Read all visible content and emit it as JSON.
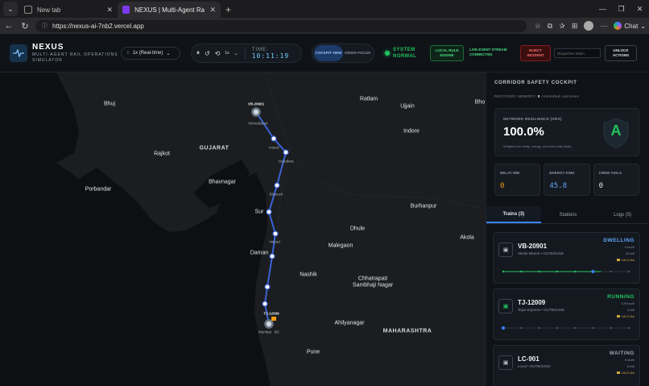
{
  "browser": {
    "tab1_title": "New tab",
    "tab2_title": "NEXUS | Multi-Agent Rail Network",
    "url": "https://nexus-ai-7nb2.vercel.app",
    "chat_label": "Chat"
  },
  "header": {
    "brand": "NEXUS",
    "subtitle_line1": "MULTI-AGENT RAIL OPERATIONS",
    "subtitle_line2": "SIMULATOR",
    "speed": "1x (Real-time)",
    "speed_step": "1x",
    "time_label": "TIME:",
    "time_value": "10:11:19",
    "mode_cockpit": "COCKPIT VIEW",
    "mode_crisis": "CRISIS FOCUS",
    "system_line1": "SYSTEM",
    "system_line2": "NORMAL",
    "rule_engine": "LOCAL RULE ENGINE",
    "event_stream_line1": "LIVE EVENT STREAM",
    "event_stream_line2": "CONNECTED",
    "inject_incident": "INJECT INCIDENT",
    "dispatcher_placeholder": "Dispatcher token",
    "unlock_actions": "UNLOCK ACTIONS"
  },
  "colors": {
    "route": "#3b63d6",
    "accent": "#3b82f6",
    "ok": "#22c55e",
    "danger": "#f87171",
    "warning": "#f59e0b"
  },
  "map": {
    "labels": {
      "bhuj": "Bhuj",
      "ratlam": "Ratlam",
      "ujjain": "Ujjain",
      "bho": "Bho",
      "indore": "Indore",
      "rajkot": "Rajkot",
      "gujarat": "GUJARAT",
      "porbandar": "Porbandar",
      "bhavnagar": "Bhavnagar",
      "burhanpur": "Burhanpur",
      "dhule": "Dhule",
      "akola": "Akola",
      "malegaon": "Malegaon",
      "nashik": "Nashik",
      "chhatrapati1": "Chhatrapati",
      "chhatrapati2": "Sambhaji Nagar",
      "maharashtra": "MAHARASHTRA",
      "ahilyanagar": "Ahilyanagar",
      "pune": "Pune",
      "surat": "Sur",
      "daman": "Daman",
      "anand": "Anand",
      "vadodara": "Vadodara",
      "bharuch": "Bharuch",
      "valsad": "Valsad",
      "ahmedabad": "Ahmedabad",
      "mumbai": "Mumbai",
      "mumbai_suffix": "BC",
      "train_vb": "VB-20901",
      "train_tj": "TJ-12009"
    }
  },
  "panel": {
    "title": "CORRIDOR SAFETY COCKPIT",
    "recovery_prefix": "RECOVERY MEMORY:",
    "recovery_count": "0",
    "recovery_suffix": "committed outcomes",
    "resilience_label": "NETWORK RESILIENCE (ORS)",
    "resilience_value": "100.0%",
    "resilience_note": "Weighted on delay, energy, and crew duty limits.",
    "grade": "A",
    "kpis": [
      {
        "label": "DELAY MIN",
        "value": "0",
        "color": "#f59e0b"
      },
      {
        "label": "ENERGY KWH",
        "value": "45.8",
        "color": "#60a5fa"
      },
      {
        "label": "CREW VIOLS",
        "value": "0",
        "color": "#e5e7eb"
      }
    ],
    "tabs": [
      "Trains (3)",
      "Stations",
      "Logs (5)"
    ],
    "trains": [
      {
        "id": "VB-20901",
        "sub": "Vande Bharat • OUTBOUND",
        "status": "DWELLING",
        "status_color": "#60a5fa",
        "speed": "0 km/h",
        "pax": "25 kW",
        "energy": "100.0 lbs",
        "progress": 0.78
      },
      {
        "id": "TJ-12009",
        "sub": "Tejas Express • OUTBOUND",
        "status": "RUNNING",
        "status_color": "#22c55e",
        "speed": "178 km/h",
        "pax": "0 kW",
        "energy": "100.0 lbs",
        "progress": 0.0
      },
      {
        "id": "LC-901",
        "sub": "Local • OUTBOUND",
        "status": "WAITING",
        "status_color": "#9ca3af",
        "speed": "0 km/h",
        "pax": "0 kW",
        "energy": "100.0 lbs",
        "progress": 0.0
      }
    ]
  }
}
